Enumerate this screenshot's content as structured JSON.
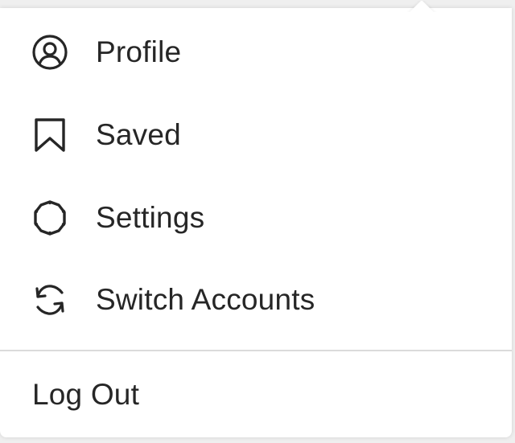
{
  "menu": {
    "items": [
      {
        "label": "Profile",
        "icon": "profile-icon"
      },
      {
        "label": "Saved",
        "icon": "bookmark-icon"
      },
      {
        "label": "Settings",
        "icon": "settings-gear-icon"
      },
      {
        "label": "Switch Accounts",
        "icon": "switch-accounts-icon"
      }
    ],
    "logout_label": "Log Out"
  },
  "colors": {
    "text": "#262626",
    "background": "#ffffff",
    "divider": "#dbdbdb",
    "backdrop": "#efefef"
  }
}
